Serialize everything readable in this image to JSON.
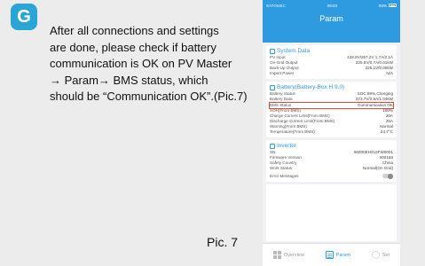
{
  "step": {
    "letter": "G"
  },
  "instruction": {
    "line1": "After all connections and settings",
    "line2": "are done, please check if battery",
    "line3": "communication is OK on PV Master",
    "line4": "→ Param→ BMS status,  which",
    "line5": "should be “Communication OK”.(Pic.7)"
  },
  "pic_label": "Pic. 7",
  "phone": {
    "status_bar": {
      "carrier": "SATOMEC",
      "time": "09:03",
      "right": "83%"
    },
    "title": "Param",
    "system_data": {
      "title": "System Data",
      "rows": [
        {
          "label": "PV Input",
          "value": "428.8V/257.2V 1.7A/2.1A"
        },
        {
          "label": "On-Grid Output",
          "value": "225.5V/0.7A/0.01kW"
        },
        {
          "label": "Back-Up Output",
          "value": "225.1V/0.00kW"
        },
        {
          "label": "Import Power",
          "value": "N/A"
        }
      ]
    },
    "battery": {
      "title": "Battery(Battery-Box H 9.0)",
      "rows": [
        {
          "label": "Battery Status",
          "value": "SOC:99%,Charging"
        },
        {
          "label": "Battery Data",
          "value": "373.7V/2.8A/1.04kW"
        },
        {
          "label": "BMS Status",
          "value": "Communication OK"
        },
        {
          "label": "SOH(From BMS)",
          "value": "100%"
        },
        {
          "label": "Charge Current Limit(From BMS)",
          "value": "20A"
        },
        {
          "label": "Discharge Current Limit(From BMS)",
          "value": "25A"
        },
        {
          "label": "Warning(From BMS)",
          "value": "Normal"
        },
        {
          "label": "Temperature(From BMS)",
          "value": "24.7°C"
        }
      ]
    },
    "inverter": {
      "title": "Inverter",
      "rows": [
        {
          "label": "SN",
          "value": "96000EH216FW0001"
        },
        {
          "label": "Firmware Version",
          "value": "000158"
        },
        {
          "label": "Safety Country",
          "value": "China"
        },
        {
          "label": "Work Status",
          "value": "Normal(On Grid)"
        }
      ],
      "error_label": "Error Messages"
    },
    "tabs": [
      {
        "label": "Overview"
      },
      {
        "label": "Param"
      },
      {
        "label": "Set"
      }
    ]
  }
}
